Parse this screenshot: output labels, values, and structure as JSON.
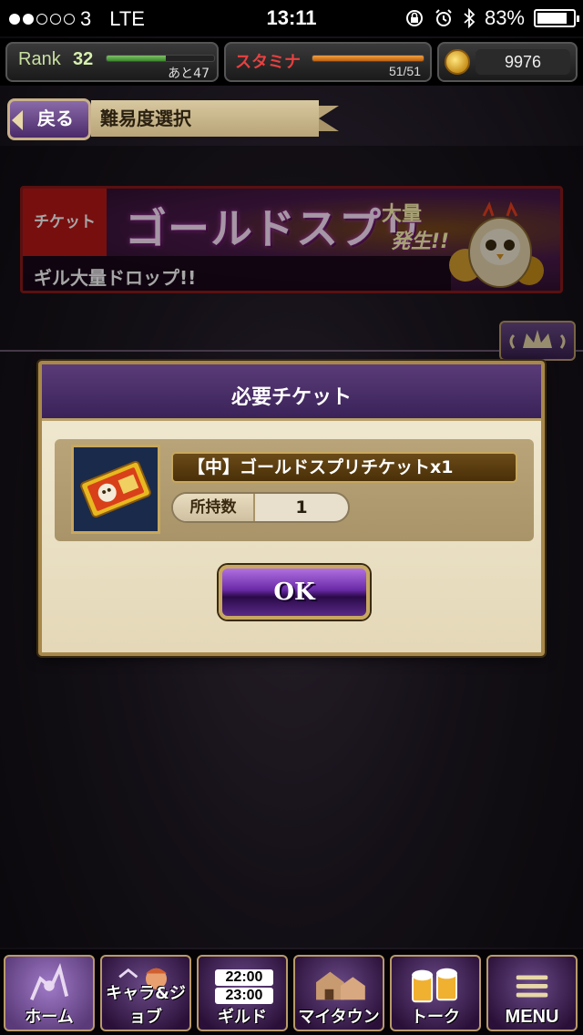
{
  "status_bar": {
    "carrier": "3",
    "network": "LTE",
    "time": "13:11",
    "battery_text": "83%",
    "battery_level": 0.83,
    "signal_dots_filled": 2,
    "signal_dots_total": 5
  },
  "hud": {
    "rank_label": "Rank",
    "rank_value": "32",
    "rank_next": "あと47",
    "rank_progress": 0.55,
    "stamina_label": "スタミナ",
    "stamina_value": "51/51",
    "stamina_progress": 1.0,
    "gil_value": "9976"
  },
  "header": {
    "back_label": "戻る",
    "title": "難易度選択"
  },
  "banner": {
    "tag": "チケット",
    "title": "ゴールドスプリ",
    "sub1": "大量",
    "sub2": "発生!!",
    "drop_text": "ギル大量ドロップ!!"
  },
  "dialog": {
    "title": "必要チケット",
    "ticket_name": "【中】ゴールドスプリチケットx1",
    "count_label": "所持数",
    "count_value": "1",
    "ok_label": "OK"
  },
  "bottom_nav": {
    "items": [
      {
        "label": "ホーム",
        "icon": "home-icon"
      },
      {
        "label": "キャラ&ジョブ",
        "icon": "character-icon"
      },
      {
        "label": "ギルド",
        "icon": "guild-icon",
        "times": [
          "22:00",
          "23:00"
        ]
      },
      {
        "label": "マイタウン",
        "icon": "town-icon"
      },
      {
        "label": "トーク",
        "icon": "talk-icon"
      },
      {
        "label": "MENU",
        "icon": "menu-icon"
      }
    ]
  },
  "colors": {
    "dialog_header": "#3a2258",
    "ok_button": "#6a2aa8",
    "frame_gold": "#c8a860",
    "stamina_label": "#e84040"
  }
}
